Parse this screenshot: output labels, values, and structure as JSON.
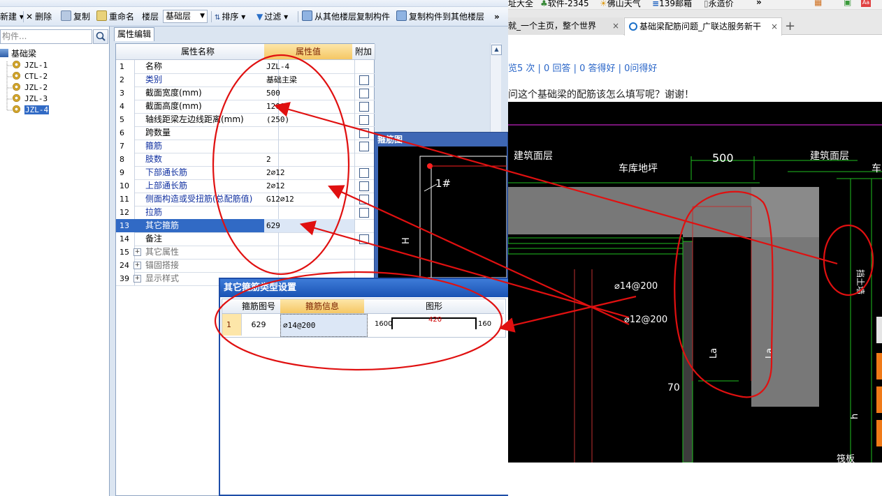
{
  "toolbar": {
    "new_label": "新建",
    "delete_label": "删除",
    "copy_label": "复制",
    "rename_label": "重命名",
    "floor_label": "楼层",
    "floor_value": "基础层",
    "sort_label": "排序",
    "filter_label": "过滤",
    "copy_from_floor_label": "从其他楼层复制构件",
    "copy_to_floor_label": "复制构件到其他楼层",
    "more_label": "»"
  },
  "sidebar": {
    "search_placeholder": "构件...",
    "root_label": "基础梁",
    "items": [
      "JZL-1",
      "CTL-2",
      "JZL-2",
      "JZL-3",
      "JZL-4"
    ]
  },
  "property_panel": {
    "tab_label": "属性编辑",
    "col_name": "属性名称",
    "col_value": "属性值",
    "col_extra": "附加",
    "rows": [
      {
        "num": "1",
        "name": "名称",
        "value": "JZL-4"
      },
      {
        "num": "2",
        "name": "类别",
        "value": "基础主梁"
      },
      {
        "num": "3",
        "name": "截面宽度(mm)",
        "value": "500"
      },
      {
        "num": "4",
        "name": "截面高度(mm)",
        "value": "1200"
      },
      {
        "num": "5",
        "name": "轴线距梁左边线距离(mm)",
        "value": "(250)"
      },
      {
        "num": "6",
        "name": "跨数量",
        "value": ""
      },
      {
        "num": "7",
        "name": "箍筋",
        "value": ""
      },
      {
        "num": "8",
        "name": "肢数",
        "value": "2"
      },
      {
        "num": "9",
        "name": "下部通长筋",
        "value": "2⌀12"
      },
      {
        "num": "10",
        "name": "上部通长筋",
        "value": "2⌀12"
      },
      {
        "num": "11",
        "name": "侧面构造或受扭筋(总配筋值)",
        "value": "G12⌀12"
      },
      {
        "num": "12",
        "name": "拉筋",
        "value": ""
      },
      {
        "num": "13",
        "name": "其它箍筋",
        "value": "629"
      },
      {
        "num": "14",
        "name": "备注",
        "value": ""
      },
      {
        "num": "15",
        "name": "其它属性",
        "value": ""
      },
      {
        "num": "24",
        "name": "锚固搭接",
        "value": ""
      },
      {
        "num": "39",
        "name": "显示样式",
        "value": ""
      }
    ]
  },
  "mini_popup": {
    "title": "箍筋图",
    "label_1": "1#",
    "label_h": "H"
  },
  "dialog": {
    "title": "其它箍筋类型设置",
    "close": "X",
    "col_shape_no": "箍筋图号",
    "col_info": "箍筋信息",
    "col_figure": "图形",
    "row_num": "1",
    "shape_no": "629",
    "info": "⌀14@200",
    "dim_left": "1600",
    "dim_top": "420",
    "dim_right": "160"
  },
  "browser": {
    "bookmarks": [
      "址大全",
      "软件-2345",
      "佛山天气",
      "139邮箱",
      "永造价",
      "»"
    ],
    "tab1_label": "就_一个主页，整个世界",
    "tab2_label": "基础梁配筋问题_广联达服务新干",
    "tab_close": "×",
    "new_tab": "+",
    "stats": "览5 次 | 0 回答 | 0 答得好 | 0问得好",
    "question": "问这个基础梁的配筋该怎么填写呢？谢谢！"
  },
  "cad": {
    "label_building_surface_left": "建筑面层",
    "label_building_surface_right": "建筑面层",
    "label_garage_floor": "车库地坪",
    "label_width": "500",
    "label_rebar_14": "⌀14@200",
    "label_rebar_12": "⌀12@200",
    "label_la": "La",
    "label_70": "70",
    "label_h": "h",
    "label_raft": "筏板",
    "label_side_wall": "挡土墙",
    "label_che": "车"
  },
  "colors": {
    "annotation_red": "#e01010",
    "selection_blue": "#316ac5",
    "header_orange": "#f5c764",
    "cad_green": "#1fbf1f",
    "cad_magenta": "#c020c0"
  }
}
